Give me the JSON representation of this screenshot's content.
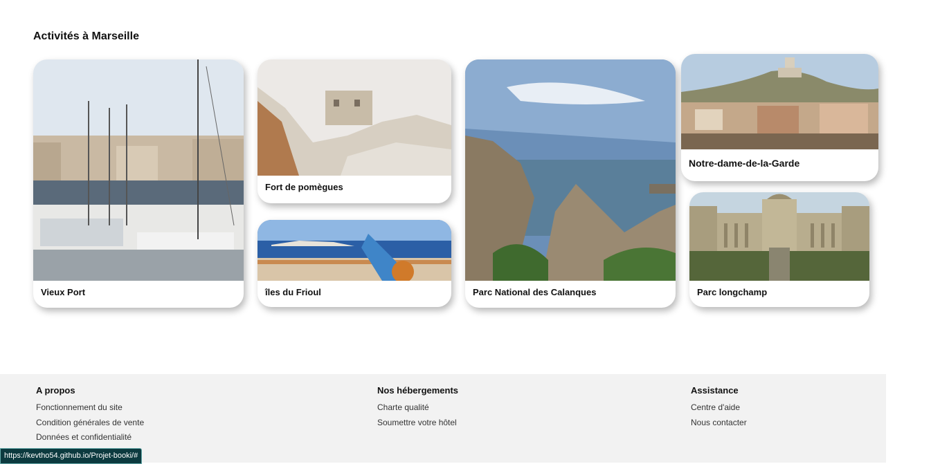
{
  "section": {
    "title": "Activités à Marseille"
  },
  "cards": [
    {
      "label": "Vieux Port"
    },
    {
      "label": "Fort de pomègues"
    },
    {
      "label": "îles du Frioul"
    },
    {
      "label": "Parc National des Calanques"
    },
    {
      "label": "Notre-dame-de-la-Garde"
    },
    {
      "label": "Parc longchamp"
    }
  ],
  "footer": {
    "columns": [
      {
        "title": "A propos",
        "links": [
          "Fonctionnement du site",
          "Condition générales de vente",
          "Données et confidentialité"
        ]
      },
      {
        "title": "Nos hébergements",
        "links": [
          "Charte qualité",
          "Soumettre votre hôtel"
        ]
      },
      {
        "title": "Assistance",
        "links": [
          "Centre d'aide",
          "Nous contacter"
        ]
      }
    ]
  },
  "status_bar": {
    "url": "https://kevtho54.github.io/Projet-booki/#"
  }
}
